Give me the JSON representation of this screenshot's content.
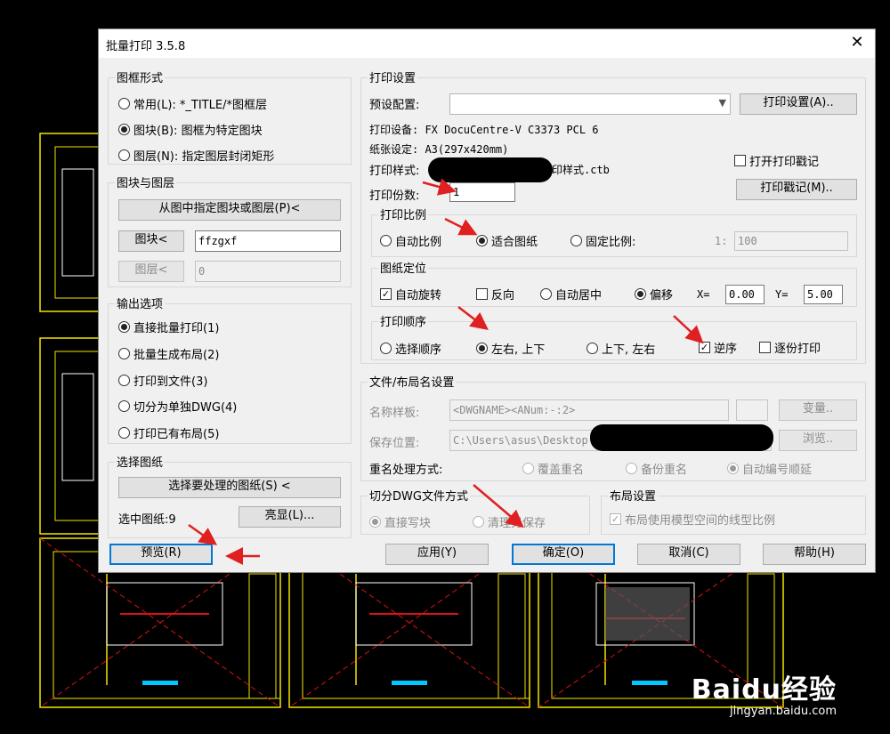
{
  "dialog": {
    "title": "批量打印 3.5.8",
    "close_glyph": "✕"
  },
  "frame_form": {
    "title": "图框形式",
    "options": [
      {
        "label": "常用(L): *_TITLE/*图框层",
        "selected": false
      },
      {
        "label": "图块(B): 图框为特定图块",
        "selected": true
      },
      {
        "label": "图层(N): 指定图层封闭矩形",
        "selected": false
      }
    ]
  },
  "block_layer": {
    "title": "图块与图层",
    "pick_button": "从图中指定图块或图层(P)<",
    "block_button": "图块<",
    "block_value": "ffzgxf",
    "layer_button": "图层<",
    "layer_value": "0"
  },
  "output": {
    "title": "输出选项",
    "options": [
      {
        "label": "直接批量打印(1)",
        "selected": true
      },
      {
        "label": "批量生成布局(2)",
        "selected": false
      },
      {
        "label": "打印到文件(3)",
        "selected": false
      },
      {
        "label": "切分为单独DWG(4)",
        "selected": false
      },
      {
        "label": "打印已有布局(5)",
        "selected": false
      }
    ]
  },
  "select_sheets": {
    "title": "选择图纸",
    "button": "选择要处理的图纸(S) <",
    "selected_label": "选中图纸:9",
    "highlight_button": "亮显(L)..."
  },
  "print_settings": {
    "title": "打印设置",
    "preset_label": "预设配置:",
    "preset_value": "",
    "settings_button": "打印设置(A)..",
    "device_label": "打印设备: FX DocuCentre-V C3373 PCL 6",
    "paper_label": "纸张设定: A3(297x420mm)",
    "style_label": "打印样式:",
    "style_value_suffix": "印样式.ctb",
    "copies_label": "打印份数:",
    "copies_value": "1",
    "open_stamp_label": "打开打印戳记",
    "stamp_button": "打印戳记(M)..",
    "scale": {
      "title": "打印比例",
      "options": [
        {
          "label": "自动比例",
          "selected": false
        },
        {
          "label": "适合图纸",
          "selected": true
        },
        {
          "label": "固定比例:",
          "selected": false
        }
      ],
      "ratio_prefix": "1:",
      "ratio_value": "100"
    },
    "position": {
      "title": "图纸定位",
      "auto_rotate": "自动旋转",
      "auto_rotate_checked": true,
      "reverse": "反向",
      "reverse_checked": false,
      "auto_center": "自动居中",
      "offset": "偏移",
      "offset_selected": true,
      "x_label": "X=",
      "x_value": "0.00",
      "y_label": "Y=",
      "y_value": "5.00"
    },
    "order": {
      "title": "打印顺序",
      "options": [
        {
          "label": "选择顺序",
          "selected": false
        },
        {
          "label": "左右, 上下",
          "selected": true
        },
        {
          "label": "上下, 左右",
          "selected": false
        }
      ],
      "reverse_label": "逆序",
      "reverse_checked": true,
      "collate_label": "逐份打印",
      "collate_checked": false
    }
  },
  "file_naming": {
    "title": "文件/布局名设置",
    "template_label": "名称样板:",
    "template_value": "<DWGNAME><ANum:-:2>",
    "variable_button": "变量..",
    "save_label": "保存位置:",
    "save_value": "C:\\Users\\asus\\Desktop",
    "browse_button": "浏览..",
    "rename_label": "重名处理方式:",
    "rename_options": [
      {
        "label": "覆盖重名",
        "selected": false
      },
      {
        "label": "备份重名",
        "selected": false
      },
      {
        "label": "自动编号顺延",
        "selected": true
      }
    ]
  },
  "split_dwg": {
    "title": "切分DWG文件方式",
    "options": [
      {
        "label": "直接写块",
        "selected": true
      },
      {
        "label": "清理另保存",
        "selected": false
      }
    ]
  },
  "layout_settings": {
    "title": "布局设置",
    "option": "布局使用模型空间的线型比例",
    "checked": true
  },
  "footer": {
    "preview": "预览(R)",
    "apply": "应用(Y)",
    "ok": "确定(O)",
    "cancel": "取消(C)",
    "help": "帮助(H)"
  },
  "watermark": {
    "brand": "Baidu经验",
    "url": "jingyan.baidu.com"
  },
  "colors": {
    "annotation_red": "#e02020",
    "cad_yellow": "#f5e400",
    "cad_red": "#d11",
    "cad_cyan": "#00c8ff"
  }
}
